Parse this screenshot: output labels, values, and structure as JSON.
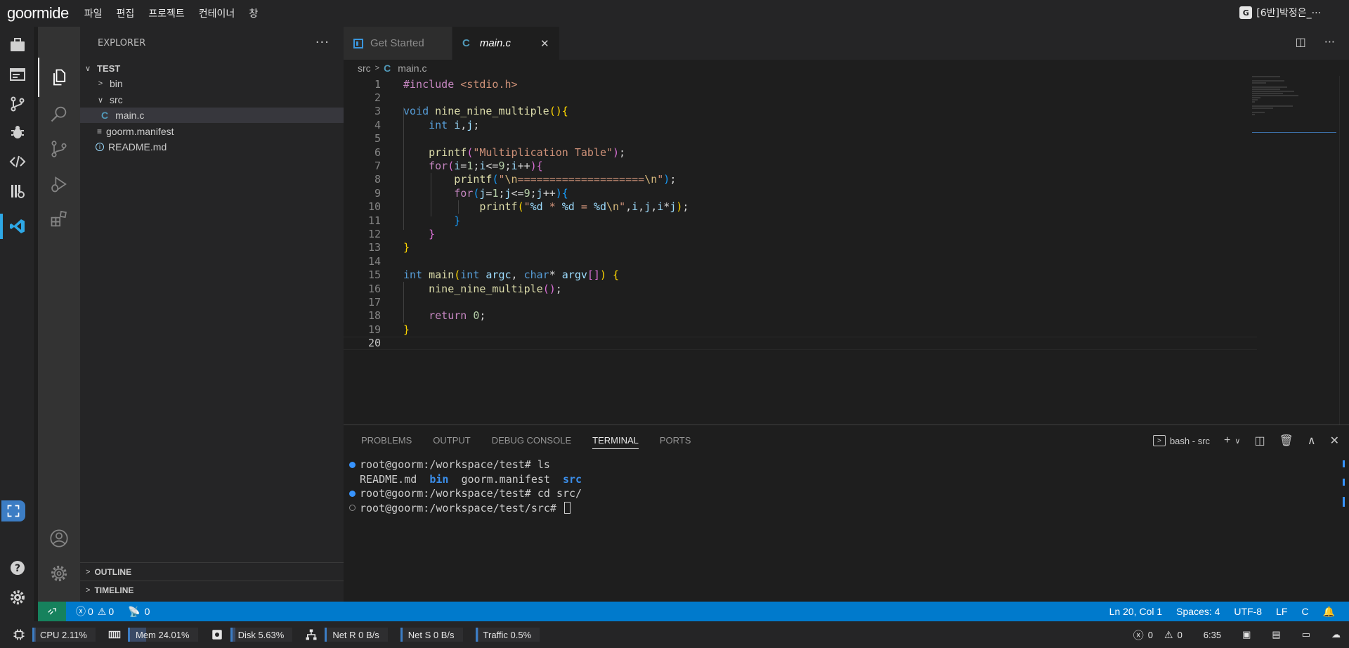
{
  "app": {
    "logo": "goormide",
    "menu": [
      "파일",
      "편집",
      "프로젝트",
      "컨테이너",
      "창"
    ],
    "user": "[6반]박정은_···"
  },
  "sidebar": {
    "title": "EXPLORER",
    "root": "TEST",
    "items": [
      {
        "label": "bin",
        "type": "folder",
        "open": false
      },
      {
        "label": "src",
        "type": "folder",
        "open": true
      },
      {
        "label": "main.c",
        "type": "c-file",
        "selected": true
      },
      {
        "label": "goorm.manifest",
        "type": "file"
      },
      {
        "label": "README.md",
        "type": "info-file"
      }
    ],
    "outline": "OUTLINE",
    "timeline": "TIMELINE"
  },
  "tabs": [
    {
      "label": "Get Started",
      "active": false
    },
    {
      "label": "main.c",
      "active": true,
      "icon": "C"
    }
  ],
  "breadcrumb": {
    "folder": "src",
    "file": "main.c"
  },
  "editor": {
    "line_numbers": [
      "1",
      "2",
      "3",
      "4",
      "5",
      "6",
      "7",
      "8",
      "9",
      "10",
      "11",
      "12",
      "13",
      "14",
      "15",
      "16",
      "17",
      "18",
      "19",
      "20"
    ],
    "current_line": 20
  },
  "panel": {
    "tabs": [
      "PROBLEMS",
      "OUTPUT",
      "DEBUG CONSOLE",
      "TERMINAL",
      "PORTS"
    ],
    "active_tab": "TERMINAL",
    "terminal_name": "bash - src",
    "lines": {
      "p1": "root@goorm:/workspace/test# ",
      "c1": "ls",
      "o1": "README.md  ",
      "o1b": "bin",
      "o1c": "  goorm.manifest  ",
      "o1d": "src",
      "p2": "root@goorm:/workspace/test# ",
      "c2": "cd src/",
      "p3": "root@goorm:/workspace/test/src# "
    }
  },
  "status": {
    "errors": "0",
    "warnings": "0",
    "ports": "0",
    "position": "Ln 20, Col 1",
    "spaces": "Spaces: 4",
    "encoding": "UTF-8",
    "eol": "LF",
    "language": "C"
  },
  "goorm_bar": {
    "cpu": "CPU 2.11%",
    "cpu_value": 2.11,
    "mem": "Mem 24.01%",
    "mem_value": 24.01,
    "disk": "Disk 5.63%",
    "disk_value": 5.63,
    "net_r": "Net R 0 B/s",
    "net_s": "Net S 0 B/s",
    "traffic": "Traffic 0.5%",
    "traffic_value": 0.5,
    "errors": "0",
    "warnings": "0",
    "time": "6:35"
  },
  "colors": {
    "status_blue": "#007acc",
    "remote_green": "#16825d",
    "accent": "#3c7dc4"
  }
}
